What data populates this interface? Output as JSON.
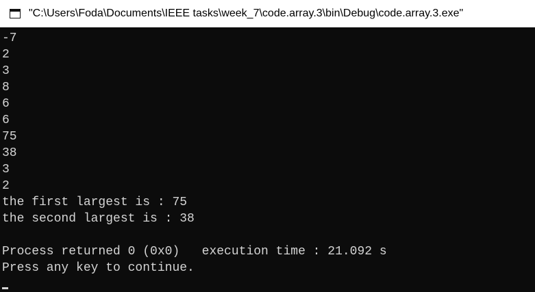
{
  "window": {
    "title": "\"C:\\Users\\Foda\\Documents\\IEEE tasks\\week_7\\code.array.3\\bin\\Debug\\code.array.3.exe\"",
    "icon": "console-window-icon"
  },
  "console": {
    "lines": [
      "-7",
      "2",
      "3",
      "8",
      "6",
      "6",
      "75",
      "38",
      "3",
      "2",
      "the first largest is : 75",
      "the second largest is : 38",
      "",
      "Process returned 0 (0x0)   execution time : 21.092 s",
      "Press any key to continue."
    ]
  },
  "colors": {
    "background": "#0c0c0c",
    "text": "#d4d4d4",
    "titlebar": "#ffffff"
  }
}
